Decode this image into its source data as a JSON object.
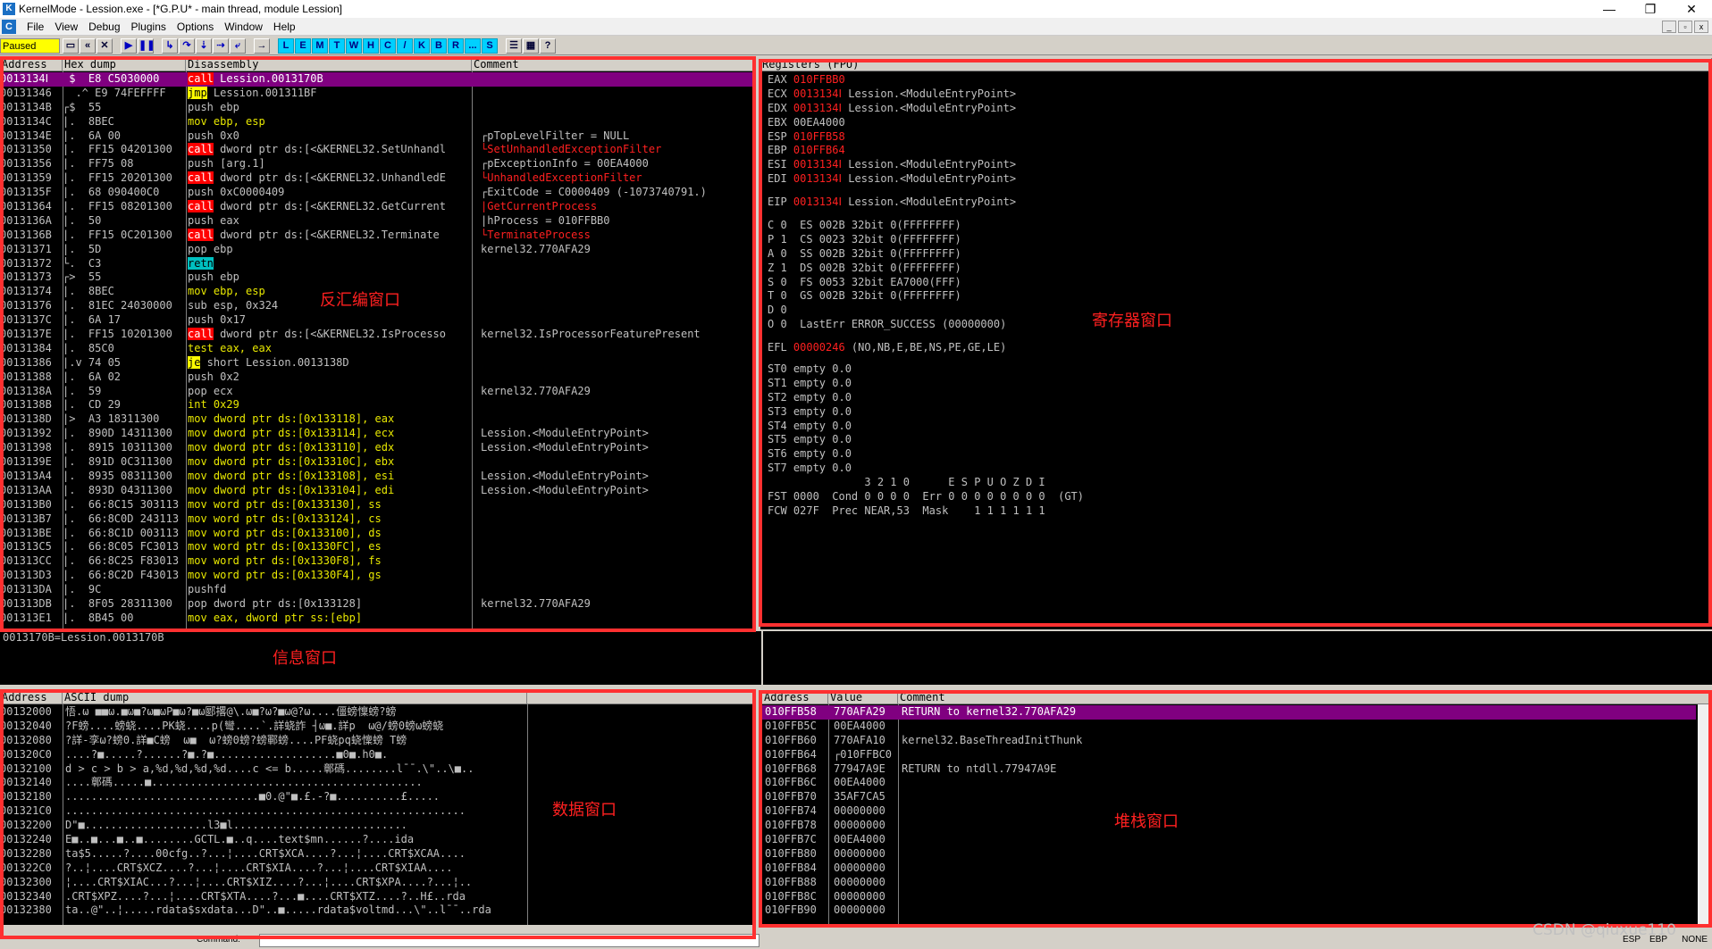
{
  "title": "KernelMode - Lession.exe - [*G.P.U* - main thread, module Lession]",
  "window_buttons": [
    "—",
    "❐",
    "✕"
  ],
  "menu": [
    "File",
    "View",
    "Debug",
    "Plugins",
    "Options",
    "Window",
    "Help"
  ],
  "status": "Paused",
  "toolbar_icons": [
    "folder-open",
    "rewind",
    "close",
    "play",
    "pause",
    "step-into",
    "step-over",
    "trace-into",
    "trace-over",
    "execute-till-return",
    "goto"
  ],
  "toolbar_letters": [
    "L",
    "E",
    "M",
    "T",
    "W",
    "H",
    "C",
    "/",
    "K",
    "B",
    "R",
    "...",
    "S"
  ],
  "labels": {
    "disasm": "反汇编窗口",
    "registers": "寄存器窗口",
    "info": "信息窗口",
    "data": "数据窗口",
    "stack": "堆栈窗口"
  },
  "watermark": "CSDN @qiuxue110",
  "statusbar": {
    "command_label": "Command:",
    "right": [
      "ESP",
      "EBP",
      "NONE"
    ]
  },
  "disasm": {
    "headers": [
      "Address",
      "Hex dump",
      "Disassembly",
      "Comment"
    ],
    "rows": [
      [
        "0013134Ⅰ",
        " $  E8 C5030000",
        "call",
        "Lession.0013170B",
        ""
      ],
      [
        "00131346",
        "  .^ E9 74FEFFFF",
        "jmp",
        "Lession.001311BF",
        ""
      ],
      [
        "0013134B",
        "┌$  55",
        "",
        "push ebp",
        ""
      ],
      [
        "0013134C",
        "|.  8BEC",
        "",
        "mov ebp, esp",
        ""
      ],
      [
        "0013134E",
        "|.  6A 00",
        "",
        "push 0x0",
        "┌pTopLevelFilter = NULL"
      ],
      [
        "00131350",
        "|.  FF15 04201300",
        "call",
        "dword ptr ds:[<&KERNEL32.SetUnhandl",
        "└SetUnhandledExceptionFilter"
      ],
      [
        "00131356",
        "|.  FF75 08",
        "",
        "push [arg.1]",
        "┌pExceptionInfo = 00EA4000"
      ],
      [
        "00131359",
        "|.  FF15 20201300",
        "call",
        "dword ptr ds:[<&KERNEL32.UnhandledE",
        "└UnhandledExceptionFilter"
      ],
      [
        "0013135F",
        "|.  68 090400C0",
        "",
        "push 0xC0000409",
        "┌ExitCode = C0000409 (-1073740791.)"
      ],
      [
        "00131364",
        "|.  FF15 08201300",
        "call",
        "dword ptr ds:[<&KERNEL32.GetCurrent",
        "|GetCurrentProcess"
      ],
      [
        "0013136A",
        "|.  50",
        "",
        "push eax",
        "|hProcess = 010FFBB0"
      ],
      [
        "0013136B",
        "|.  FF15 0C201300",
        "call",
        "dword ptr ds:[<&KERNEL32.Terminate",
        "└TerminateProcess"
      ],
      [
        "00131371",
        "|.  5D",
        "",
        "pop ebp",
        "kernel32.770AFA29"
      ],
      [
        "00131372",
        "└.  C3",
        "retn",
        "",
        ""
      ],
      [
        "00131373",
        "┌>  55",
        "",
        "push ebp",
        ""
      ],
      [
        "00131374",
        "|.  8BEC",
        "",
        "mov ebp, esp",
        ""
      ],
      [
        "00131376",
        "|.  81EC 24030000",
        "",
        "sub esp, 0x324",
        ""
      ],
      [
        "0013137C",
        "|.  6A 17",
        "",
        "push 0x17",
        ""
      ],
      [
        "0013137E",
        "|.  FF15 10201300",
        "call",
        "dword ptr ds:[<&KERNEL32.IsProcesso",
        "kernel32.IsProcessorFeaturePresent"
      ],
      [
        "00131384",
        "|.  85C0",
        "",
        "test eax, eax",
        ""
      ],
      [
        "00131386",
        "|.v 74 05",
        "je",
        "short Lession.0013138D",
        ""
      ],
      [
        "00131388",
        "|.  6A 02",
        "",
        "push 0x2",
        ""
      ],
      [
        "0013138A",
        "|.  59",
        "",
        "pop ecx",
        "kernel32.770AFA29"
      ],
      [
        "0013138B",
        "|.  CD 29",
        "",
        "int 0x29",
        ""
      ],
      [
        "0013138D",
        "|>  A3 18311300",
        "",
        "mov dword ptr ds:[0x133118], eax",
        ""
      ],
      [
        "00131392",
        "|.  890D 14311300",
        "",
        "mov dword ptr ds:[0x133114], ecx",
        "Lession.<ModuleEntryPoint>"
      ],
      [
        "00131398",
        "|.  8915 10311300",
        "",
        "mov dword ptr ds:[0x133110], edx",
        "Lession.<ModuleEntryPoint>"
      ],
      [
        "0013139E",
        "|.  891D 0C311300",
        "",
        "mov dword ptr ds:[0x13310C], ebx",
        ""
      ],
      [
        "001313A4",
        "|.  8935 08311300",
        "",
        "mov dword ptr ds:[0x133108], esi",
        "Lession.<ModuleEntryPoint>"
      ],
      [
        "001313AA",
        "|.  893D 04311300",
        "",
        "mov dword ptr ds:[0x133104], edi",
        "Lession.<ModuleEntryPoint>"
      ],
      [
        "001313B0",
        "|.  66:8C15 303113",
        "",
        "mov word ptr ds:[0x133130], ss",
        ""
      ],
      [
        "001313B7",
        "|.  66:8C0D 243113",
        "",
        "mov word ptr ds:[0x133124], cs",
        ""
      ],
      [
        "001313BE",
        "|.  66:8C1D 003113",
        "",
        "mov word ptr ds:[0x133100], ds",
        ""
      ],
      [
        "001313C5",
        "|.  66:8C05 FC3013",
        "",
        "mov word ptr ds:[0x1330FC], es",
        ""
      ],
      [
        "001313CC",
        "|.  66:8C25 F83013",
        "",
        "mov word ptr ds:[0x1330F8], fs",
        ""
      ],
      [
        "001313D3",
        "|.  66:8C2D F43013",
        "",
        "mov word ptr ds:[0x1330F4], gs",
        ""
      ],
      [
        "001313DA",
        "|.  9C",
        "",
        "pushfd",
        ""
      ],
      [
        "001313DB",
        "|.  8F05 28311300",
        "",
        "pop dword ptr ds:[0x133128]",
        "kernel32.770AFA29"
      ],
      [
        "001313E1",
        "|.  8B45 00",
        "",
        "mov eax, dword ptr ss:[ebp]",
        ""
      ]
    ]
  },
  "registers": {
    "header": "Registers (FPU)",
    "lines": [
      {
        "n": "EAX",
        "v": "010FFBB0",
        "c": ""
      },
      {
        "n": "ECX",
        "v": "0013134Ⅰ",
        "c": "Lession.<ModuleEntryPoint>"
      },
      {
        "n": "EDX",
        "v": "0013134Ⅰ",
        "c": "Lession.<ModuleEntryPoint>"
      },
      {
        "n": "EBX",
        "v": "00EA4000",
        "c": "",
        "w": true
      },
      {
        "n": "ESP",
        "v": "010FFB58",
        "c": ""
      },
      {
        "n": "EBP",
        "v": "010FFB64",
        "c": ""
      },
      {
        "n": "ESI",
        "v": "0013134Ⅰ",
        "c": "Lession.<ModuleEntryPoint>"
      },
      {
        "n": "EDI",
        "v": "0013134Ⅰ",
        "c": "Lession.<ModuleEntryPoint>"
      }
    ],
    "eip": {
      "n": "EIP",
      "v": "0013134Ⅰ",
      "c": "Lession.<ModuleEntryPoint>"
    },
    "flags": [
      "C 0  ES 002B 32bit 0(FFFFFFFF)",
      "P 1  CS 0023 32bit 0(FFFFFFFF)",
      "A 0  SS 002B 32bit 0(FFFFFFFF)",
      "Z 1  DS 002B 32bit 0(FFFFFFFF)",
      "S 0  FS 0053 32bit EA7000(FFF)",
      "T 0  GS 002B 32bit 0(FFFFFFFF)",
      "D 0",
      "O 0  LastErr ERROR_SUCCESS (00000000)"
    ],
    "efl": {
      "n": "EFL",
      "v": "00000246",
      "c": "(NO,NB,E,BE,NS,PE,GE,LE)"
    },
    "fpu": [
      "ST0 empty 0.0",
      "ST1 empty 0.0",
      "ST2 empty 0.0",
      "ST3 empty 0.0",
      "ST4 empty 0.0",
      "ST5 empty 0.0",
      "ST6 empty 0.0",
      "ST7 empty 0.0"
    ],
    "fpu_tail": [
      "               3 2 1 0      E S P U O Z D I",
      "FST 0000  Cond 0 0 0 0  Err 0 0 0 0 0 0 0 0  (GT)",
      "FCW 027F  Prec NEAR,53  Mask    1 1 1 1 1 1"
    ]
  },
  "info": {
    "text": "0013170B=Lession.0013170B"
  },
  "dump": {
    "headers": [
      "Address",
      "ASCII dump"
    ],
    "rows": [
      [
        "00132000",
        "悟.ω ■■ω.■ω■?ω■ωP■ω?■ω郾撂@\\.ω■?ω?■ω@?ω....僵螃懍螃?螃"
      ],
      [
        "00132040",
        "?F螃....螃蛲....PK蛲....p(彎....`.詳蛲詐 ┤ω■.詳p  ω@/螃0螃ω螃蛲"
      ],
      [
        "00132080",
        "?詳-孪ω?螃0.詳■C螃  ω■  ω?螃0螃?螃鄆螃....PF蛲pq蛲懍螃 T螃"
      ],
      [
        "001320C0",
        "....?■.....?......?■.?■...................■0■.h0■."
      ],
      [
        "00132100",
        "d > c > b > a,%d,%d,%d,%d....c <= b.....鄣碼........l¯¯.\\\"..\\■.."
      ],
      [
        "00132140",
        "....鄣碼.....■.........................................."
      ],
      [
        "00132180",
        "..............................■0.@\"■.£.-?■..........£....."
      ],
      [
        "001321C0",
        ".............................................................."
      ],
      [
        "00132200",
        "D\"■...................l3■l..........................."
      ],
      [
        "00132240",
        "E■..■...■..■........GCTL.■..q....text$mn......?....ida"
      ],
      [
        "00132280",
        "ta$5.....?....00cfg..?...¦....CRT$XCA....?...¦....CRT$XCAA...."
      ],
      [
        "001322C0",
        "?..¦....CRT$XCZ....?...¦....CRT$XIA....?...¦....CRT$XIAA...."
      ],
      [
        "00132300",
        "¦....CRT$XIAC...?...¦....CRT$XIZ....?...¦....CRT$XPA....?...¦.."
      ],
      [
        "00132340",
        ".CRT$XPZ....?...¦....CRT$XTA....?...■....CRT$XTZ....?..H£..rda"
      ],
      [
        "00132380",
        "ta..@\"..¦.....rdata$sxdata...D\"..■.....rdata$voltmd...\\\"..l¯¯..rda"
      ]
    ]
  },
  "stack": {
    "headers": [
      "Address",
      "Value",
      "Comment"
    ],
    "rows": [
      [
        "010FFB58",
        "770AFA29",
        "RETURN to kernel32.770AFA29"
      ],
      [
        "010FFB5C",
        "00EA4000",
        ""
      ],
      [
        "010FFB60",
        "770AFA10",
        "kernel32.BaseThreadInitThunk"
      ],
      [
        "010FFB64",
        "┌010FFBC0",
        ""
      ],
      [
        "010FFB68",
        "77947A9E",
        "RETURN to ntdll.77947A9E"
      ],
      [
        "010FFB6C",
        "00EA4000",
        ""
      ],
      [
        "010FFB70",
        "35AF7CA5",
        ""
      ],
      [
        "010FFB74",
        "00000000",
        ""
      ],
      [
        "010FFB78",
        "00000000",
        ""
      ],
      [
        "010FFB7C",
        "00EA4000",
        ""
      ],
      [
        "010FFB80",
        "00000000",
        ""
      ],
      [
        "010FFB84",
        "00000000",
        ""
      ],
      [
        "010FFB88",
        "00000000",
        ""
      ],
      [
        "010FFB8C",
        "00000000",
        ""
      ],
      [
        "010FFB90",
        "00000000",
        ""
      ]
    ]
  }
}
